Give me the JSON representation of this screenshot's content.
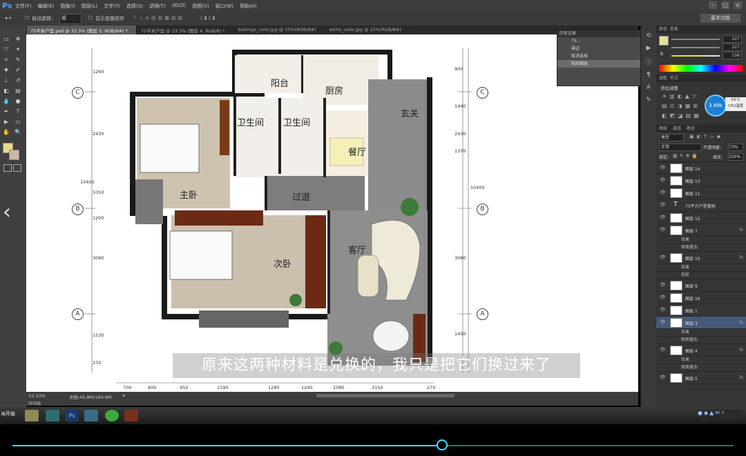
{
  "app": {
    "logo": "Ps"
  },
  "menu": [
    "文件(F)",
    "编辑(E)",
    "图像(I)",
    "图层(L)",
    "文字(Y)",
    "选择(S)",
    "滤镜(T)",
    "3D(D)",
    "视图(V)",
    "窗口(W)",
    "帮助(H)"
  ],
  "options": {
    "auto_select_label": "自动选择：",
    "auto_select_value": "组",
    "transform_label": "显示变换控件",
    "workspace": "基本功能"
  },
  "tabs": [
    "75平米户型.psd @ 33.3% (图层 3, RGB/8#) *",
    "75平米户型 @ 33.3% (图层 4, RGB/8) *",
    "bubinga_color.jpg @ 25%(RGB/8#)",
    "eiche_color.jpg @ 25%(RGB/8#)"
  ],
  "history": {
    "title": "历史记录",
    "items": [
      "75...",
      "描边",
      "取消选择",
      "粘贴图层"
    ]
  },
  "color_panel": {
    "tab1": "颜色",
    "tab2": "色板",
    "values": [
      "227",
      "227",
      "156"
    ],
    "label_b": "B"
  },
  "adjust": {
    "tab1": "调整",
    "tab2": "样式",
    "title": "添加调整"
  },
  "weather": {
    "badge": "3.89k",
    "temp": "49°C",
    "cpu": "CPU温度"
  },
  "layers": {
    "tabs": [
      "图层",
      "通道",
      "路径"
    ],
    "kind": "类型",
    "mode": "正常",
    "opacity_label": "不透明度：",
    "opacity": "73%",
    "lock_label": "锁定：",
    "fill_label": "填充：",
    "fill": "100%",
    "rows": [
      {
        "name": "图层 14",
        "fx": ""
      },
      {
        "name": "图层 13",
        "fx": ""
      },
      {
        "name": "图层 11",
        "fx": ""
      },
      {
        "name": "75平方户型案例",
        "fx": "",
        "text": true
      },
      {
        "name": "图层 12",
        "fx": ""
      },
      {
        "name": "图层 7",
        "fx": "fx"
      },
      {
        "sub": "效果"
      },
      {
        "sub": "图案叠加"
      },
      {
        "name": "图层 10",
        "fx": "fx"
      },
      {
        "sub": "效果"
      },
      {
        "sub": "投影"
      },
      {
        "name": "图层 9",
        "fx": ""
      },
      {
        "name": "图层 16",
        "fx": ""
      },
      {
        "name": "图层 1",
        "fx": ""
      },
      {
        "name": "图层 3",
        "fx": "fx",
        "sel": true
      },
      {
        "sub": "效果"
      },
      {
        "sub": "图案叠加"
      },
      {
        "name": "图层 4",
        "fx": "fx"
      },
      {
        "sub": "效果"
      },
      {
        "sub": "图案叠加"
      },
      {
        "name": "图层 5",
        "fx": "fx"
      }
    ]
  },
  "plan": {
    "rooms": [
      "阳台",
      "厨房",
      "卫生间",
      "卫生间",
      "玄关",
      "主卧",
      "餐厅",
      "过道",
      "客厅",
      "次卧"
    ],
    "axes": [
      "C",
      "B",
      "A",
      "C",
      "B",
      "A"
    ],
    "top_dims": [
      "1260",
      "2430",
      "1050",
      "1200"
    ],
    "left_dims": [
      "10400",
      "3080",
      "1530",
      "270"
    ],
    "right_dims": [
      "900",
      "1440",
      "1370",
      "2430",
      "10400",
      "3080",
      "1450"
    ],
    "bottom_dims": [
      "700",
      "800",
      "950",
      "1590",
      "1280",
      "1290",
      "1080",
      "3150",
      "270"
    ]
  },
  "status": {
    "zoom": "33.33%",
    "doc": "文档:45.8M/160.8M",
    "timeline": "时间轴"
  },
  "taskbar": {
    "start": "开始"
  },
  "subtitle": "原来这两种材料是兑换的，我只是把它们换过来了",
  "video": {
    "progress": 0.596
  }
}
